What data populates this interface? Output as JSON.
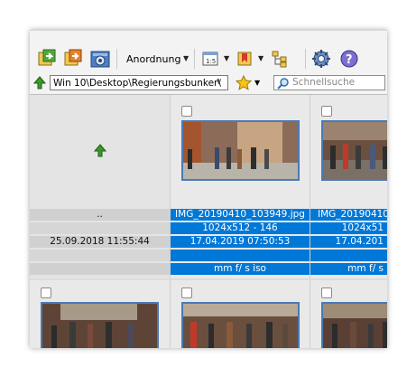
{
  "toolbar": {
    "arrange_label": "Anordnung"
  },
  "address": {
    "path": "Win 10\\Desktop\\Regierungsbunker\\",
    "search_placeholder": "Schnellsuche"
  },
  "parent_folder": {
    "name": "..",
    "date": "25.09.2018 11:55:44"
  },
  "files": [
    {
      "name": "IMG_20190410_103949.jpg",
      "dims": "1024x512 - 146",
      "date": "17.04.2019 07:50:53",
      "exif": "mm f/ s iso"
    },
    {
      "name": "IMG_20190410",
      "dims": "1024x51",
      "date": "17.04.201",
      "exif": "mm f/ s"
    }
  ],
  "colors": {
    "selection": "#0078d7",
    "accent_green": "#3a9a2a"
  }
}
